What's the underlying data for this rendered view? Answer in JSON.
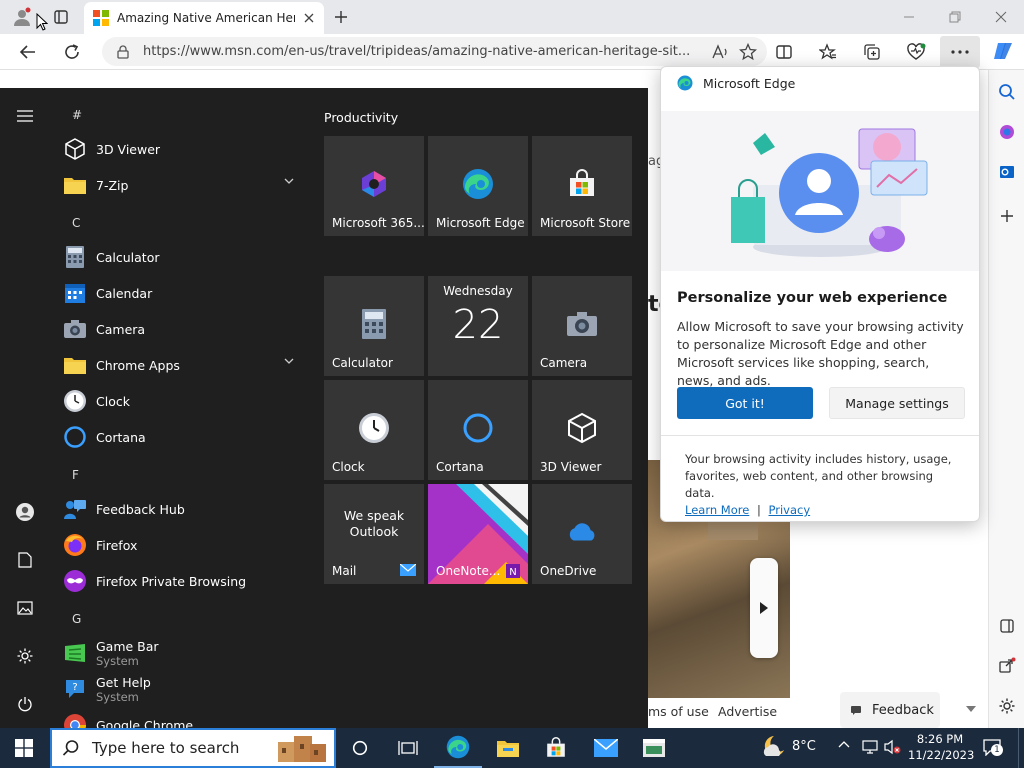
{
  "browser": {
    "tab_title": "Amazing Native American Herita",
    "url": "https://www.msn.com/en-us/travel/tripideas/amazing-native-american-heritage-sit..."
  },
  "page": {
    "partial_text_1": "ag",
    "partial_text_2": "te",
    "footer_terms": "ms of use",
    "footer_advertise": "Advertise",
    "feedback_label": "Feedback"
  },
  "start_menu": {
    "sections": {
      "hash": "#",
      "c": "C",
      "f": "F",
      "g": "G"
    },
    "apps": [
      {
        "name": "3D Viewer"
      },
      {
        "name": "7-Zip"
      },
      {
        "name": "Calculator"
      },
      {
        "name": "Calendar"
      },
      {
        "name": "Camera"
      },
      {
        "name": "Chrome Apps"
      },
      {
        "name": "Clock"
      },
      {
        "name": "Cortana"
      },
      {
        "name": "Feedback Hub"
      },
      {
        "name": "Firefox"
      },
      {
        "name": "Firefox Private Browsing"
      },
      {
        "name": "Game Bar",
        "sub": "System"
      },
      {
        "name": "Get Help",
        "sub": "System"
      },
      {
        "name": "Google Chrome"
      }
    ],
    "tiles_header": "Productivity",
    "tiles": [
      {
        "label": "Microsoft 365..."
      },
      {
        "label": "Microsoft Edge"
      },
      {
        "label": "Microsoft Store"
      },
      {
        "label": "Calculator"
      },
      {
        "label": "Wednesday",
        "day": "22"
      },
      {
        "label": "Camera"
      },
      {
        "label": "Clock"
      },
      {
        "label": "Cortana"
      },
      {
        "label": "3D Viewer"
      },
      {
        "label": "Mail",
        "text": "We speak Outlook"
      },
      {
        "label": "OneNote..."
      },
      {
        "label": "OneDrive"
      }
    ]
  },
  "popup": {
    "app_name": "Microsoft Edge",
    "heading": "Personalize your web experience",
    "body": "Allow Microsoft to save your browsing activity to personalize Microsoft Edge and other Microsoft services like shopping, search, news, and ads.",
    "primary_button": "Got it!",
    "secondary_button": "Manage settings",
    "footer_text": "Your browsing activity includes history, usage, favorites, web content, and other browsing data.",
    "learn_more": "Learn More",
    "divider": "|",
    "privacy": "Privacy"
  },
  "taskbar": {
    "search_placeholder": "Type here to search",
    "temperature": "8°C",
    "time": "8:26 PM",
    "date": "11/22/2023",
    "notification_count": "1"
  },
  "colors": {
    "accent_blue": "#0f6cbd",
    "start_bg": "#1f1f1f",
    "tile_bg": "#353535",
    "taskbar_bg": "#1b2a3d"
  }
}
